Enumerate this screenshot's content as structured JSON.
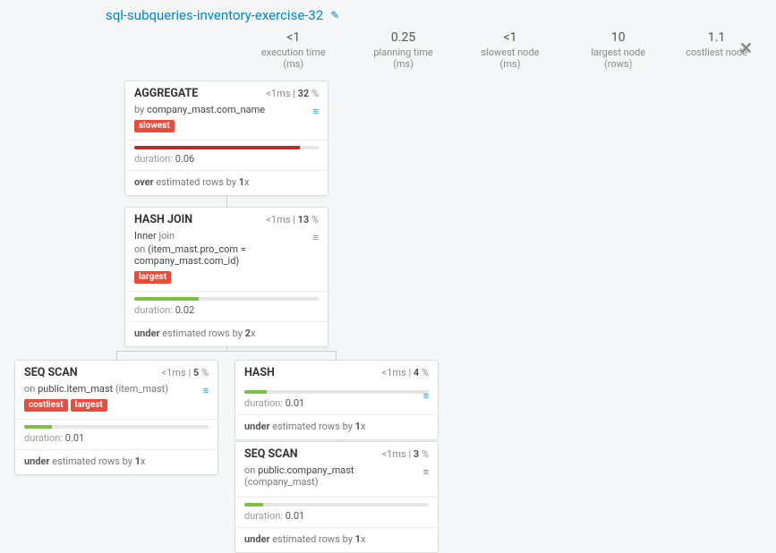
{
  "title": "sql-subqueries-inventory-exercise-32",
  "icons": {
    "edit": "✎",
    "close": "✕",
    "disk": "≡"
  },
  "stats": [
    {
      "value": "<1",
      "label": "execution time (ms)"
    },
    {
      "value": "0.25",
      "label": "planning time (ms)"
    },
    {
      "value": "<1",
      "label": "slowest node (ms)"
    },
    {
      "value": "10",
      "label": "largest node (rows)"
    },
    {
      "value": "1.1",
      "label": "costliest node"
    }
  ],
  "nodes": {
    "aggregate": {
      "title": "AGGREGATE",
      "time_prefix": "<1",
      "time_unit": "ms",
      "pct": "32",
      "pct_unit": "%",
      "detail_prefix": "by ",
      "detail_strong": "company_mast.com_name",
      "badges": [
        "slowest"
      ],
      "bar_color": "red",
      "bar_width": "90%",
      "duration_label": "duration: ",
      "duration_value": "0.06",
      "est_strong1": "over",
      "est_mid": " estimated rows by ",
      "est_strong2": "1",
      "est_suffix": "x"
    },
    "hashjoin": {
      "title": "HASH JOIN",
      "time_prefix": "<1",
      "time_unit": "ms",
      "pct": "13",
      "pct_unit": "%",
      "detail_line1_a": "Inner ",
      "detail_line1_b": "join",
      "detail_line2_a": "on ",
      "detail_line2_b": "(item_mast.pro_com = company_mast.com_id)",
      "badges": [
        "largest"
      ],
      "bar_color": "green",
      "bar_width": "35%",
      "duration_label": "duration: ",
      "duration_value": "0.02",
      "est_strong1": "under",
      "est_mid": " estimated rows by ",
      "est_strong2": "2",
      "est_suffix": "x"
    },
    "seqscan_item": {
      "title": "SEQ SCAN",
      "time_prefix": "<1",
      "time_unit": "ms",
      "pct": "5",
      "pct_unit": "%",
      "detail_prefix": "on ",
      "detail_strong": "public.item_mast",
      "detail_paren": " (item_mast)",
      "badges": [
        "costliest",
        "largest"
      ],
      "bar_color": "green",
      "bar_width": "15%",
      "duration_label": "duration: ",
      "duration_value": "0.01",
      "est_strong1": "under",
      "est_mid": " estimated rows by ",
      "est_strong2": "1",
      "est_suffix": "x"
    },
    "hash": {
      "title": "HASH",
      "time_prefix": "<1",
      "time_unit": "ms",
      "pct": "4",
      "pct_unit": "%",
      "bar_color": "green",
      "bar_width": "12%",
      "duration_label": "duration: ",
      "duration_value": "0.01",
      "est_strong1": "under",
      "est_mid": " estimated rows by ",
      "est_strong2": "1",
      "est_suffix": "x"
    },
    "seqscan_company": {
      "title": "SEQ SCAN",
      "time_prefix": "<1",
      "time_unit": "ms",
      "pct": "3",
      "pct_unit": "%",
      "detail_prefix": "on ",
      "detail_strong": "public.company_mast",
      "detail_paren": " (company_mast)",
      "bar_color": "green",
      "bar_width": "10%",
      "duration_label": "duration: ",
      "duration_value": "0.01",
      "est_strong1": "under",
      "est_mid": " estimated rows by ",
      "est_strong2": "1",
      "est_suffix": "x"
    }
  }
}
